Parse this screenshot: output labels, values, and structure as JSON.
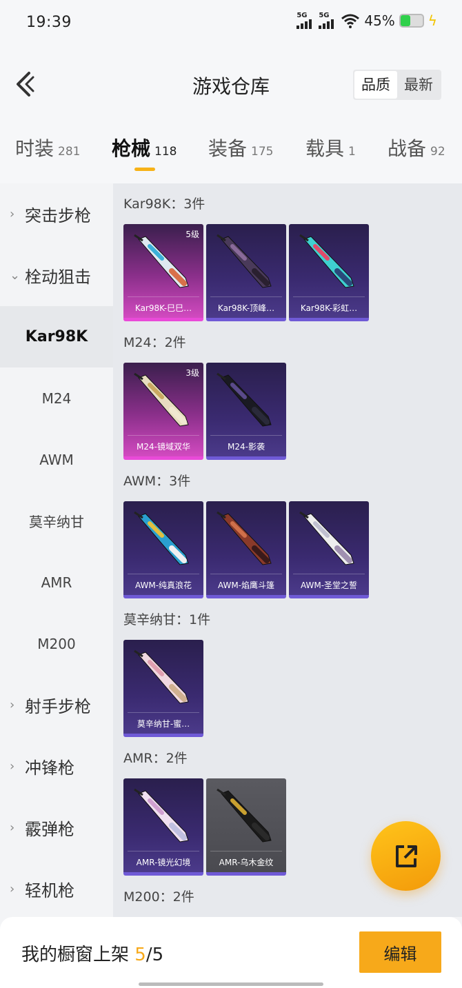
{
  "status": {
    "time": "19:39",
    "signal1": "5G",
    "signal2": "5G",
    "battery": "45%"
  },
  "header": {
    "title": "游戏仓库",
    "sort_quality": "品质",
    "sort_newest": "最新"
  },
  "tabs": [
    {
      "label": "时装",
      "count": "281"
    },
    {
      "label": "枪械",
      "count": "118"
    },
    {
      "label": "装备",
      "count": "175"
    },
    {
      "label": "载具",
      "count": "1"
    },
    {
      "label": "战备",
      "count": "92"
    }
  ],
  "sidebar": {
    "categories": [
      "突击步枪",
      "栓动狙击",
      "射手步枪",
      "冲锋枪",
      "霰弹枪",
      "轻机枪"
    ],
    "sub": [
      "Kar98K",
      "M24",
      "AWM",
      "莫辛纳甘",
      "AMR",
      "M200"
    ]
  },
  "groups": [
    {
      "title": "Kar98K：3件",
      "items": [
        {
          "name": "Kar98K-巳巳…",
          "level": "5级",
          "rarity": "pink"
        },
        {
          "name": "Kar98K-顶峰…",
          "level": "",
          "rarity": "purple"
        },
        {
          "name": "Kar98K-彩虹…",
          "level": "",
          "rarity": "purple"
        }
      ]
    },
    {
      "title": "M24：2件",
      "items": [
        {
          "name": "M24-镜域双华",
          "level": "3级",
          "rarity": "pink"
        },
        {
          "name": "M24-影袭",
          "level": "",
          "rarity": "purple"
        }
      ]
    },
    {
      "title": "AWM：3件",
      "items": [
        {
          "name": "AWM-纯真浪花",
          "level": "",
          "rarity": "purple"
        },
        {
          "name": "AWM-焰鹰斗篷",
          "level": "",
          "rarity": "purple"
        },
        {
          "name": "AWM-圣堂之誓",
          "level": "",
          "rarity": "purple"
        }
      ]
    },
    {
      "title": "莫辛纳甘：1件",
      "items": [
        {
          "name": "莫辛纳甘-蜜…",
          "level": "",
          "rarity": "purple"
        }
      ]
    },
    {
      "title": "AMR：2件",
      "items": [
        {
          "name": "AMR-镜光幻境",
          "level": "",
          "rarity": "purple"
        },
        {
          "name": "AMR-乌木金纹",
          "level": "",
          "rarity": "gray"
        }
      ]
    },
    {
      "title": "M200：2件",
      "items": []
    }
  ],
  "bottom": {
    "shelf_label": "我的橱窗上架",
    "shelf_used": "5",
    "shelf_total": "/5",
    "edit": "编辑"
  },
  "colors": {
    "accent": "#f7a91a",
    "rare_purple": "#6f5ad6",
    "rare_pink": "#e94ad8"
  }
}
